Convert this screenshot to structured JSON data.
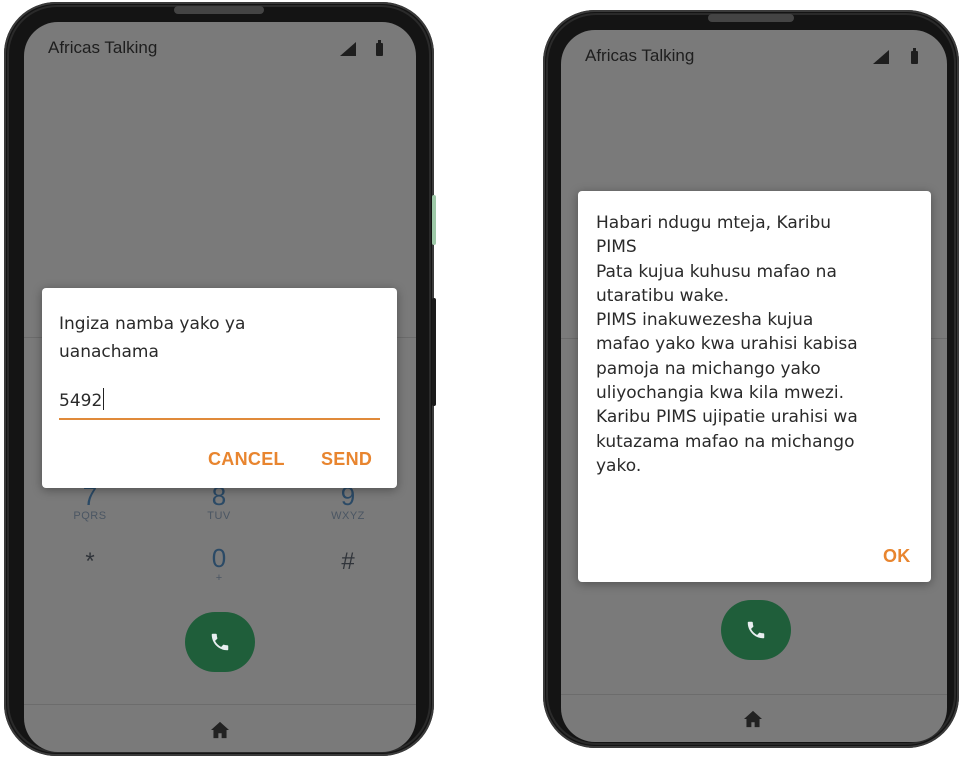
{
  "left_phone": {
    "status": {
      "app_name": "Africas Talking"
    },
    "dialog": {
      "message_lines": [
        "Ingiza namba yako ya",
        "uanachama"
      ],
      "input_value": "5492",
      "cancel_label": "CANCEL",
      "send_label": "SEND"
    },
    "dialpad": [
      {
        "digit": "7",
        "letters": "PQRS"
      },
      {
        "digit": "8",
        "letters": "TUV"
      },
      {
        "digit": "9",
        "letters": "WXYZ"
      },
      {
        "digit": "*",
        "letters": ""
      },
      {
        "digit": "0",
        "letters": "+"
      },
      {
        "digit": "#",
        "letters": ""
      }
    ],
    "call_icon": "phone-icon",
    "home_icon": "home-icon"
  },
  "right_phone": {
    "status": {
      "app_name": "Africas Talking"
    },
    "dialog": {
      "message_lines": [
        "Habari ndugu mteja, Karibu",
        "PIMS",
        "Pata kujua kuhusu mafao na",
        "utaratibu wake.",
        "PIMS inakuwezesha kujua",
        "mafao yako kwa urahisi kabisa",
        "pamoja na michango yako",
        "uliyochangia kwa kila mwezi.",
        "Karibu PIMS ujipatie urahisi wa",
        "kutazama mafao na michango",
        "yako."
      ],
      "ok_label": "OK"
    },
    "call_icon": "phone-icon",
    "home_icon": "home-icon"
  },
  "colors": {
    "accent": "#e8852f",
    "screen_overlay": "#7a7a7a",
    "call_button": "#1f5e3a",
    "phone_frame": "#141414"
  }
}
